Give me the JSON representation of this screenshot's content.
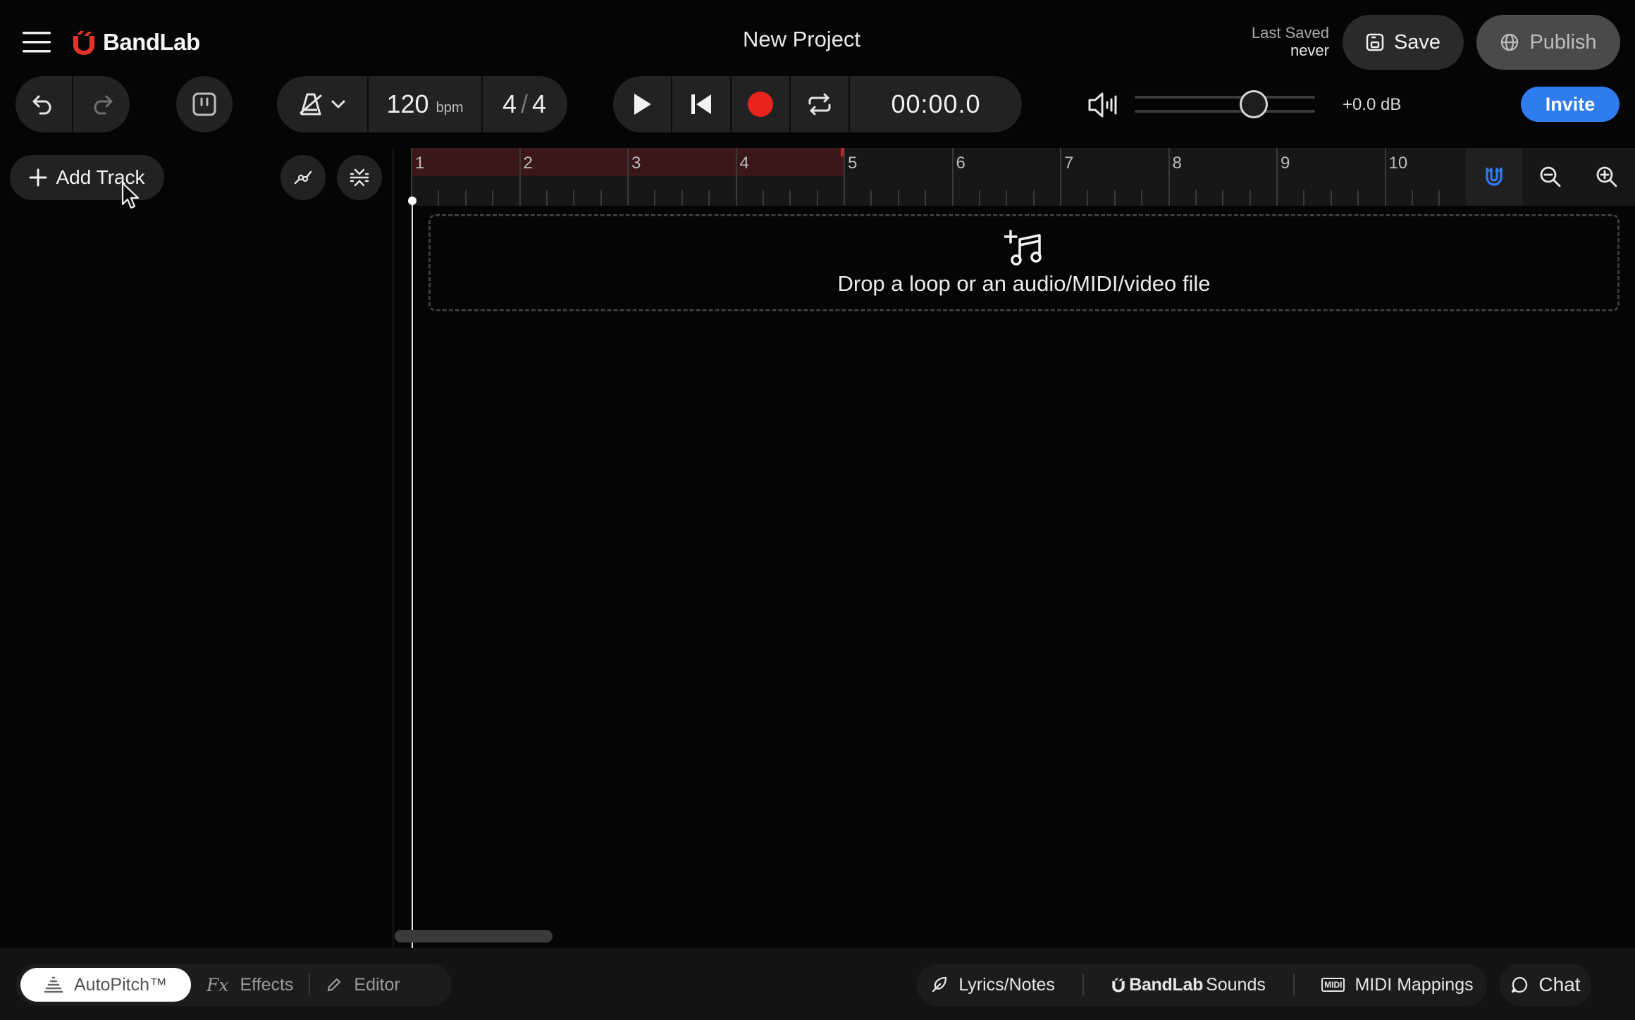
{
  "app": {
    "brand": "BandLab",
    "project_title": "New Project",
    "brand_color": "#e5332a",
    "accent_color": "#2f7bf0"
  },
  "header": {
    "last_saved_label": "Last Saved",
    "last_saved_value": "never",
    "save_label": "Save",
    "publish_label": "Publish"
  },
  "toolbar": {
    "tempo_value": "120",
    "tempo_unit": "bpm",
    "time_sig_top": "4",
    "time_sig_sep": "/",
    "time_sig_bottom": "4",
    "time_display": "00:00.0",
    "volume_db": "+0.0 dB",
    "volume_level": 0.66,
    "invite_label": "Invite",
    "record_color": "#e8241c"
  },
  "tracks_panel": {
    "add_track_label": "Add Track"
  },
  "timeline": {
    "bars": [
      "1",
      "2",
      "3",
      "4",
      "5",
      "6",
      "7",
      "8",
      "9",
      "10"
    ],
    "loop_start_bar": 1,
    "loop_end_bar": 5,
    "drop_text": "Drop a loop or an audio/MIDI/video file"
  },
  "bottom": {
    "tabs": [
      {
        "label": "AutoPitch™",
        "icon": "autopitch-icon"
      },
      {
        "label": "Effects",
        "icon_text": "Fx"
      },
      {
        "label": "Editor",
        "icon": "pencil-icon"
      }
    ],
    "lyrics_label": "Lyrics/Notes",
    "sounds_brand": "BandLab",
    "sounds_label": "Sounds",
    "midi_label": "MIDI Mappings",
    "midi_icon_text": "MIDI",
    "chat_label": "Chat"
  }
}
